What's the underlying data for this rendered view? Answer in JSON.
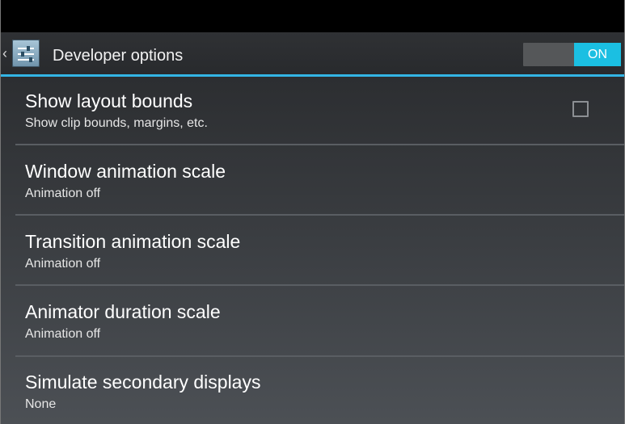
{
  "action_bar": {
    "title": "Developer options",
    "up_icon": "chevron-left-icon",
    "app_icon": "settings-sliders-icon",
    "toggle": {
      "state_label": "ON",
      "checked": true
    }
  },
  "colors": {
    "accent": "#33b5e5",
    "toggle_on": "#1bbfe2"
  },
  "preferences": [
    {
      "title": "Show layout bounds",
      "summary": "Show clip bounds, margins, etc.",
      "has_checkbox": true,
      "checked": false
    },
    {
      "title": "Window animation scale",
      "summary": "Animation off"
    },
    {
      "title": "Transition animation scale",
      "summary": "Animation off"
    },
    {
      "title": "Animator duration scale",
      "summary": "Animation off"
    },
    {
      "title": "Simulate secondary displays",
      "summary": "None"
    }
  ]
}
